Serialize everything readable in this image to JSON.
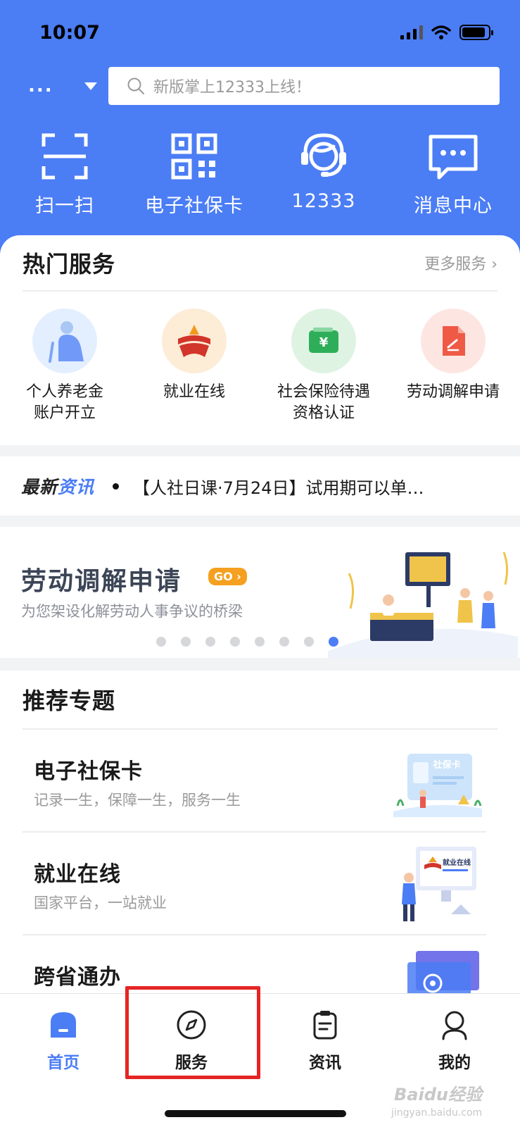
{
  "status_bar": {
    "time": "10:07"
  },
  "header": {
    "city": "...",
    "search_placeholder": "新版掌上12333上线！",
    "quick_actions": [
      {
        "label": "扫一扫",
        "icon": "scan-icon"
      },
      {
        "label": "电子社保卡",
        "icon": "qr-code-icon"
      },
      {
        "label": "12333",
        "icon": "customer-service-icon"
      },
      {
        "label": "消息中心",
        "icon": "message-icon"
      }
    ]
  },
  "hot_services": {
    "title": "热门服务",
    "more": "更多服务 ›",
    "items": [
      {
        "line1": "个人养老金",
        "line2": "账户开立",
        "icon": "elderly-person-icon",
        "bg": "#e3efff"
      },
      {
        "line1": "就业在线",
        "line2": "",
        "icon": "employment-logo-icon",
        "bg": "#fdecd6"
      },
      {
        "line1": "社会保险待遇",
        "line2": "资格认证",
        "icon": "wallet-icon",
        "bg": "#dff3e3"
      },
      {
        "line1": "劳动调解申请",
        "line2": "",
        "icon": "document-edit-icon",
        "bg": "#fde6e2"
      }
    ]
  },
  "news": {
    "logo_black": "最新",
    "logo_blue": "资讯",
    "headline": "【人社日课·7月24日】试用期可以单…"
  },
  "banner": {
    "title": "劳动调解申请",
    "go": "GO ›",
    "subtitle": "为您架设化解劳动人事争议的桥梁",
    "active_index": 7,
    "dot_count": 8
  },
  "topics": {
    "title": "推荐专题",
    "items": [
      {
        "title": "电子社保卡",
        "subtitle": "记录一生，保障一生，服务一生"
      },
      {
        "title": "就业在线",
        "subtitle": "国家平台，一站就业"
      },
      {
        "title": "跨省通办",
        "subtitle": ""
      }
    ],
    "card_label": "社保卡",
    "screen_label": "就业在线"
  },
  "tabbar": {
    "tabs": [
      {
        "label": "首页",
        "icon": "home-icon",
        "active": true
      },
      {
        "label": "服务",
        "icon": "compass-icon",
        "active": false
      },
      {
        "label": "资讯",
        "icon": "clipboard-icon",
        "active": false
      },
      {
        "label": "我的",
        "icon": "user-icon",
        "active": false
      }
    ]
  },
  "watermark": {
    "text": "Baidu经验",
    "sub": "jingyan.baidu.com"
  },
  "colors": {
    "primary": "#4b7df5",
    "highlight": "#e52525",
    "go": "#f5a020"
  }
}
